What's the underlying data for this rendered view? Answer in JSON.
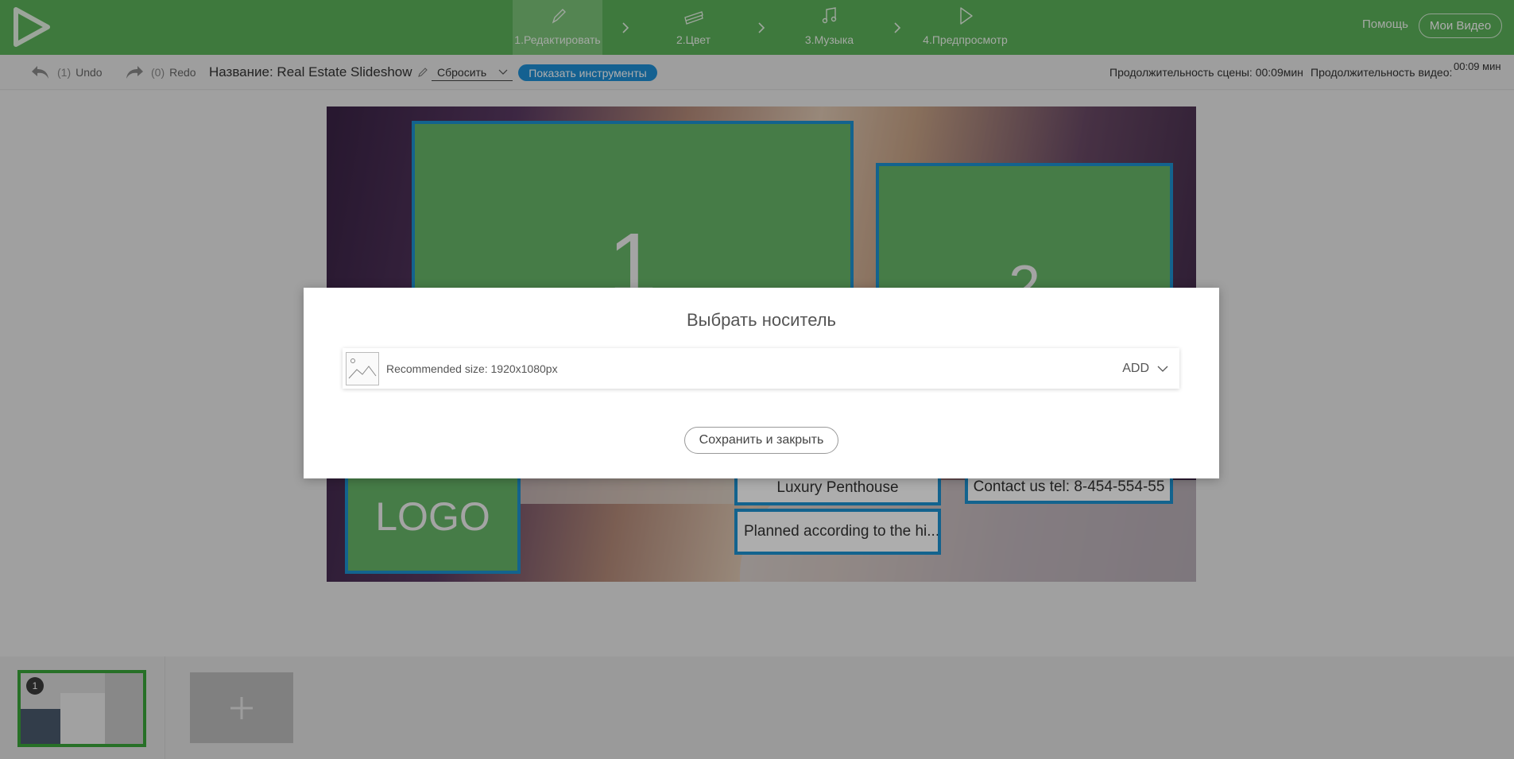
{
  "header": {
    "steps": [
      {
        "label": "1.Редактировать",
        "icon": "pencil-icon"
      },
      {
        "label": "2.Цвет",
        "icon": "palette-icon"
      },
      {
        "label": "3.Музыка",
        "icon": "music-note-icon"
      },
      {
        "label": "4.Предпросмотр",
        "icon": "play-icon"
      }
    ],
    "help": "Помощь",
    "my_videos": "Мои Видео"
  },
  "toolbar": {
    "undo_count": "(1)",
    "undo_label": "Undo",
    "redo_count": "(0)",
    "redo_label": "Redo",
    "title_label": "Название: Real Estate Slideshow",
    "reset_label": "Сбросить",
    "show_tools": "Показать инструменты",
    "scene_duration": "Продолжительность сцены: 00:09мин",
    "video_duration_label": "Продолжительность видео:",
    "video_duration_value": "00:09 мин"
  },
  "slide": {
    "placeholder_1": "1",
    "placeholder_2": "2",
    "logo": "LOGO",
    "luxury": "Luxury Penthouse",
    "planned": "Planned according to the hi...",
    "contact": "Contact us tel: 8-454-554-55"
  },
  "modal": {
    "title": "Выбрать носитель",
    "hint": "Recommended size: 1920x1080px",
    "add": "ADD",
    "save_close": "Сохранить и закрыть"
  },
  "scenes": {
    "badge": "1",
    "add_symbol": "+"
  },
  "colors": {
    "brand_green": "#5cb35a",
    "accent_blue": "#1e90d6",
    "placeholder_green": "#67b769"
  }
}
